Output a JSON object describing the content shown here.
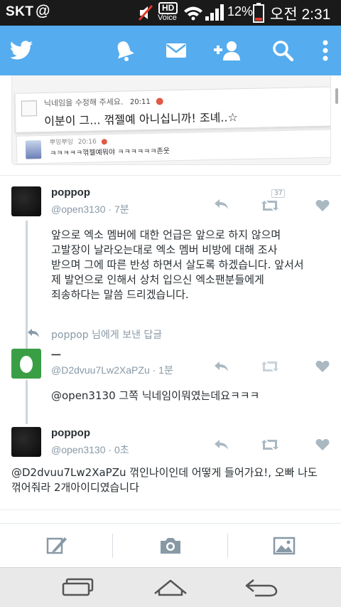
{
  "status_bar": {
    "carrier": "SKT",
    "at_symbol": "@",
    "hd_label": "HD",
    "voice_label": "Voice",
    "battery_percent": "12%",
    "time": "오전 2:31"
  },
  "app_bar": {
    "icons": [
      "twitter-bird-icon",
      "notifications-icon",
      "messages-icon",
      "add-user-icon",
      "search-icon",
      "more-options-icon"
    ]
  },
  "attachment": {
    "row1_meta": "닉네임을 수정해 주세요.",
    "row1_time": "20:11",
    "row1_text": "이분이 그... 꺾젤예 아니십니까! 조녜..☆",
    "row2_meta": "뿌잉뿌잉",
    "row2_time": "20:16",
    "row2_text": "ㅋㅋㅋㅋㅋ꺾젤예뭐야 ㅋㅋㅋㅋㅋㅋ존웃"
  },
  "tweets": [
    {
      "name": "poppop",
      "handle": "@open3130 · 7분",
      "retweet_count": "37",
      "text_lines": [
        "앞으로 엑소 멤버에 대한 언급은 앞으로 하지 않으며",
        "고발장이 날라오는대로 엑소 멤버 비방에 대해 조사",
        "받으며 그에 따른 반성 하면서 살도록 하겠습니다. 앞서서",
        "제 발언으로 인해서 상처 입으신 엑소팬분들에게",
        "죄송하다는 말씀 드리겠습니다."
      ]
    },
    {
      "reply_to": "poppop 님에게 보낸 답글",
      "name": "ㅡ",
      "handle": "@D2dvuu7Lw2XaPZu · 1분",
      "text": "@open3130 그쪽 닉네임이뭐였는데요ㅋㅋㅋ"
    },
    {
      "name": "poppop",
      "handle": "@open3130 · 0초",
      "text_lines": [
        "@D2dvuu7Lw2XaPZu 꺾인나이인데 어떻게 들어가요!, 오빠 나도",
        "꺾어줘라 2개아이디였습니다"
      ]
    }
  ],
  "composer": {
    "icons": [
      "compose-tweet-icon",
      "camera-icon",
      "gallery-icon"
    ]
  },
  "nav_bar": {
    "icons": [
      "recent-apps-icon",
      "home-icon",
      "back-icon"
    ]
  },
  "colors": {
    "twitter_blue": "#55acee",
    "status_bar_bg": "#1a1a1a",
    "muted_text": "#8899a6",
    "body_text": "#292f33",
    "egg_avatar_green": "#3a9e45"
  }
}
